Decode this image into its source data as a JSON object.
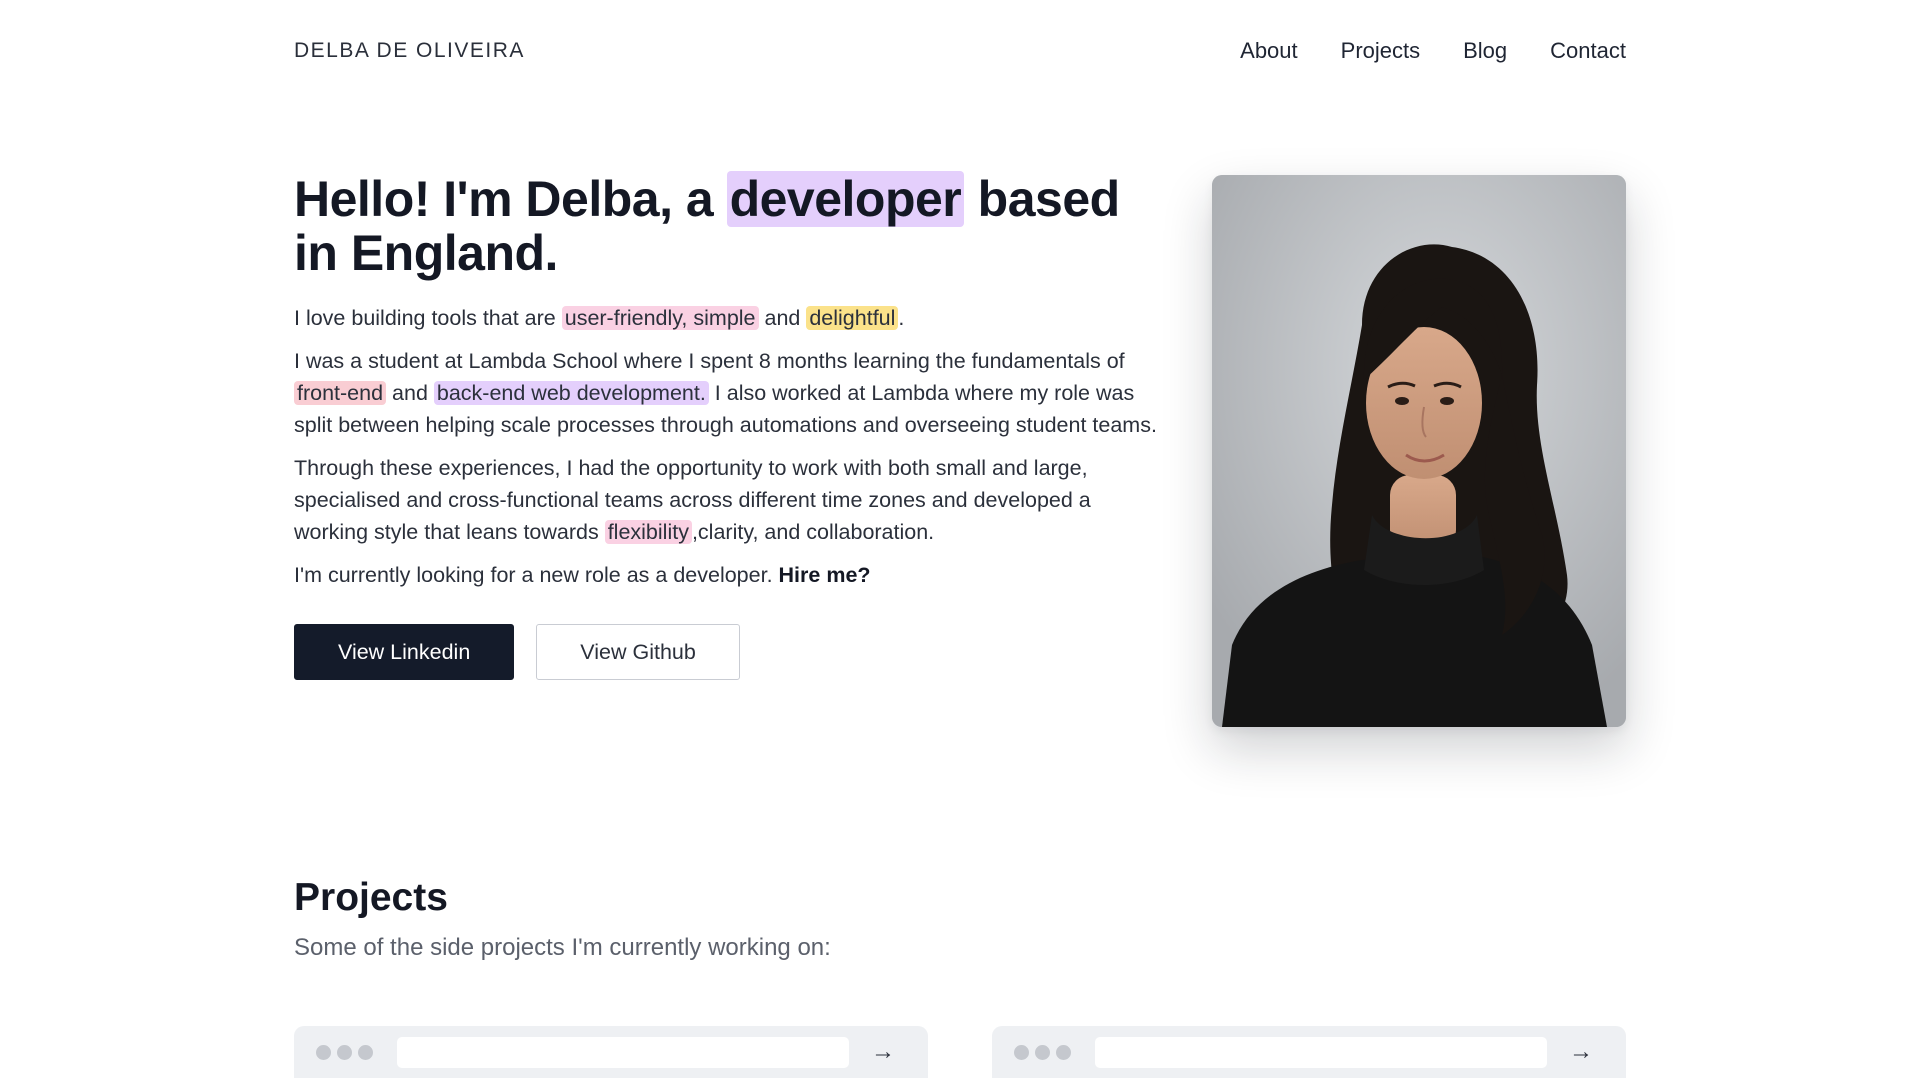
{
  "nav": {
    "brand": "DELBA DE OLIVEIRA",
    "links": [
      {
        "label": "About"
      },
      {
        "label": "Projects"
      },
      {
        "label": "Blog"
      },
      {
        "label": "Contact"
      }
    ]
  },
  "hero": {
    "heading_pre": "Hello! I'm Delba, a ",
    "heading_highlight": "developer",
    "heading_post": " based in England.",
    "p1_pre": "I love building tools that are ",
    "p1_hl1": "user-friendly, simple",
    "p1_mid": " and ",
    "p1_hl2": "delightful",
    "p1_post": ".",
    "p2_pre": "I was a student at Lambda School where I spent 8 months learning the fundamentals of ",
    "p2_hl1": "front-end",
    "p2_mid": " and ",
    "p2_hl2": "back-end web development.",
    "p2_post": " I also worked at Lambda where my role was split between helping scale processes through automations and overseeing student teams.",
    "p3_pre": "Through these experiences, I had the opportunity to work with both small and large, specialised and cross-functional teams across different time zones and developed a working style that leans towards ",
    "p3_hl": "flexibility",
    "p3_post": ",clarity, and collaboration.",
    "p4_pre": "I'm currently looking for a new role as a developer. ",
    "p4_strong": "Hire me?",
    "linkedin_button": "View Linkedin",
    "github_button": "View Github"
  },
  "projects": {
    "title": "Projects",
    "subtitle": "Some of the side projects I'm currently working on:",
    "cards": [
      {
        "arrow_icon": "arrow-right-icon"
      },
      {
        "arrow_icon": "arrow-right-icon"
      }
    ]
  },
  "colors": {
    "highlight_purple": "#e4cffc",
    "highlight_pink": "#fad1e3",
    "highlight_yellow": "#fbe28a",
    "primary_button": "#141b2a"
  }
}
